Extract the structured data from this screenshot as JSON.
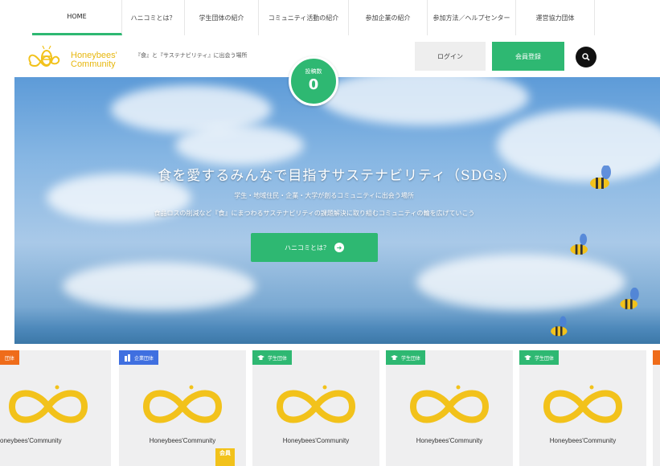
{
  "nav": {
    "items": [
      {
        "label": "HOME"
      },
      {
        "label": "ハニコミとは？"
      },
      {
        "label": "学生団体の紹介"
      },
      {
        "label": "コミュニティ活動の紹介"
      },
      {
        "label": "参加企業の紹介"
      },
      {
        "label": "参加方法／ヘルプセンター"
      },
      {
        "label": "運営協力団体"
      }
    ]
  },
  "header": {
    "logo_line1": "Honeybees'",
    "logo_line2": "Community",
    "tagline": "『食』と『サステナビリティ』に出会う場所",
    "login_label": "ログイン",
    "register_label": "会員登録"
  },
  "counter": {
    "label": "投稿数",
    "value": "0"
  },
  "hero": {
    "title": "食を愛するみんなで目指すサステナビリティ（SDGs）",
    "subtitle1": "学生・地域住民・企業・大学が創るコミュニティに出会う場所",
    "subtitle2": "食品ロスの削減など『食』にまつわるサステナビリティの課題解決に取り組むコミュニティの輪を広げていこう",
    "button_label": "ハニコミとは？"
  },
  "cards": [
    {
      "badge": "団体",
      "badge_color": "#ef6c1a",
      "name": "oneybees'Community"
    },
    {
      "badge": "企業団体",
      "badge_color": "#3f6fe0",
      "name": "Honeybees'Community",
      "member_tag": "会員"
    },
    {
      "badge": "学生団体",
      "badge_color": "#2eb872",
      "name": "Honeybees'Community"
    },
    {
      "badge": "学生団体",
      "badge_color": "#2eb872",
      "name": "Honeybees'Community"
    },
    {
      "badge": "学生団体",
      "badge_color": "#2eb872",
      "name": "Honeybees'Community"
    }
  ],
  "colors": {
    "accent": "#2eb872",
    "brand_yellow": "#f2c21b"
  }
}
